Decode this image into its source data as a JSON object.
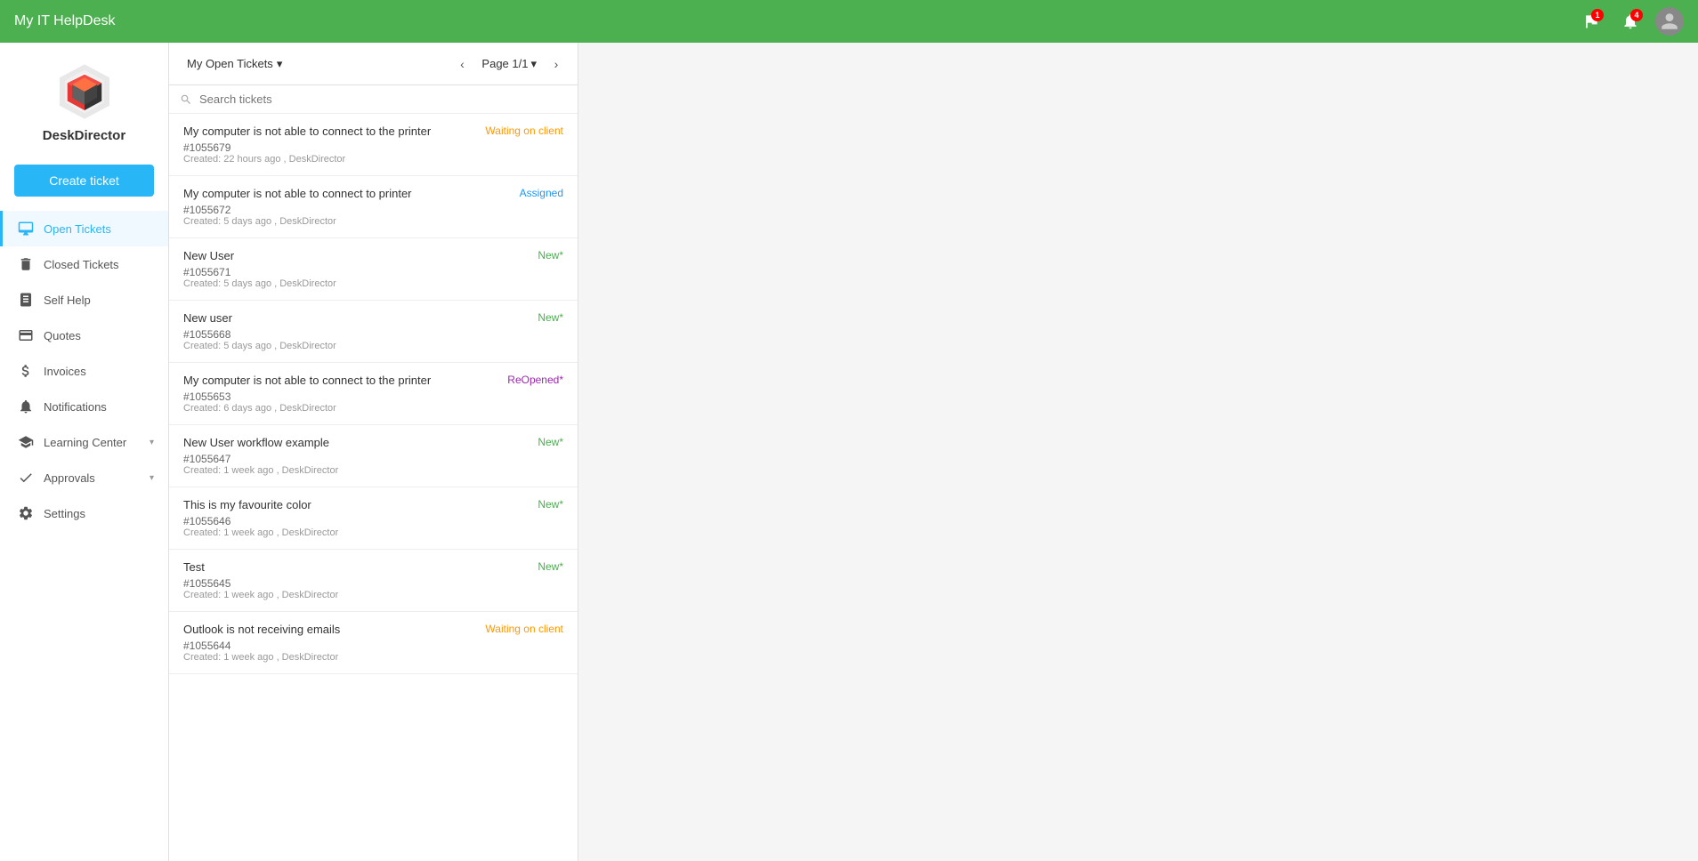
{
  "topbar": {
    "title": "My IT HelpDesk",
    "flag_badge": "1",
    "bell_badge": "4"
  },
  "logo": {
    "text": "DeskDirector"
  },
  "create_ticket": {
    "label": "Create ticket"
  },
  "sidebar": {
    "items": [
      {
        "id": "open-tickets",
        "label": "Open Tickets",
        "active": true,
        "icon": "monitor-icon"
      },
      {
        "id": "closed-tickets",
        "label": "Closed Tickets",
        "active": false,
        "icon": "trash-icon"
      },
      {
        "id": "self-help",
        "label": "Self Help",
        "active": false,
        "icon": "book-icon"
      },
      {
        "id": "quotes",
        "label": "Quotes",
        "active": false,
        "icon": "card-icon"
      },
      {
        "id": "invoices",
        "label": "Invoices",
        "active": false,
        "icon": "dollar-icon"
      },
      {
        "id": "notifications",
        "label": "Notifications",
        "active": false,
        "icon": "bell-icon"
      },
      {
        "id": "learning-center",
        "label": "Learning Center",
        "active": false,
        "icon": "learning-icon",
        "hasArrow": true
      },
      {
        "id": "approvals",
        "label": "Approvals",
        "active": false,
        "icon": "approvals-icon",
        "hasArrow": true
      },
      {
        "id": "settings",
        "label": "Settings",
        "active": false,
        "icon": "gear-icon"
      }
    ]
  },
  "tickets_panel": {
    "filter_label": "My Open Tickets",
    "page_label": "Page 1/1",
    "search_placeholder": "Search tickets",
    "tickets": [
      {
        "title": "My computer is not able to connect to the printer",
        "status": "Waiting on client",
        "status_class": "status-waiting",
        "id": "#1055679",
        "meta": "Created: 22 hours ago , DeskDirector"
      },
      {
        "title": "My computer is not able to connect to printer",
        "status": "Assigned",
        "status_class": "status-assigned",
        "id": "#1055672",
        "meta": "Created: 5 days ago , DeskDirector"
      },
      {
        "title": "New User",
        "status": "New*",
        "status_class": "status-new",
        "id": "#1055671",
        "meta": "Created: 5 days ago , DeskDirector"
      },
      {
        "title": "New user",
        "status": "New*",
        "status_class": "status-new",
        "id": "#1055668",
        "meta": "Created: 5 days ago , DeskDirector"
      },
      {
        "title": "My computer is not able to connect to the printer",
        "status": "ReOpened*",
        "status_class": "status-reopened",
        "id": "#1055653",
        "meta": "Created: 6 days ago , DeskDirector"
      },
      {
        "title": "New User workflow example",
        "status": "New*",
        "status_class": "status-new",
        "id": "#1055647",
        "meta": "Created: 1 week ago , DeskDirector"
      },
      {
        "title": "This is my favourite color",
        "status": "New*",
        "status_class": "status-new",
        "id": "#1055646",
        "meta": "Created: 1 week ago , DeskDirector"
      },
      {
        "title": "Test",
        "status": "New*",
        "status_class": "status-new",
        "id": "#1055645",
        "meta": "Created: 1 week ago , DeskDirector"
      },
      {
        "title": "Outlook is not receiving emails",
        "status": "Waiting on client",
        "status_class": "status-waiting",
        "id": "#1055644",
        "meta": "Created: 1 week ago , DeskDirector"
      }
    ]
  }
}
